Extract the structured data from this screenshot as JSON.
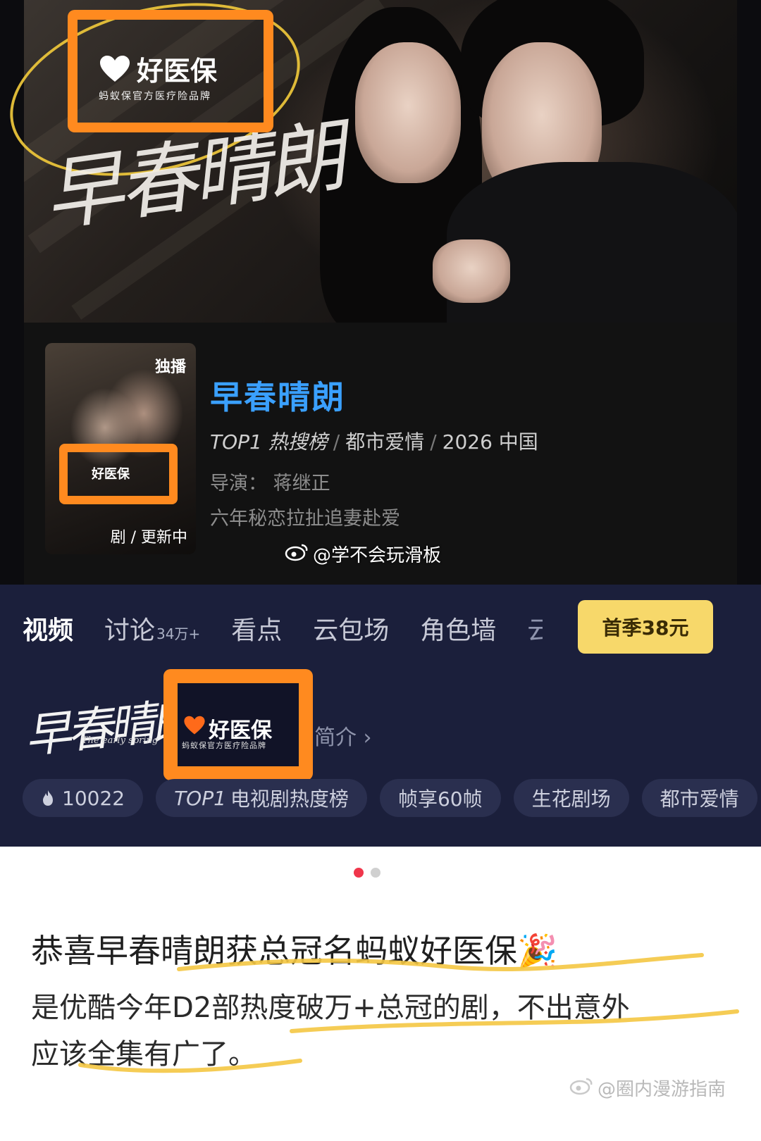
{
  "hero": {
    "title_art": "早春晴朗",
    "sponsor_logo": {
      "name": "好医保",
      "subtitle": "蚂蚁保官方医疗险品牌"
    }
  },
  "show": {
    "poster_badge": "独播",
    "poster_status": "剧 / 更新中",
    "poster_logo": "好医保",
    "title": "早春晴朗",
    "meta": {
      "rank": "TOP1 热搜榜",
      "genre": "都市爱情",
      "year_region": "2026 中国"
    },
    "director": "导演：  蒋继正",
    "tagline": "六年秘恋拉扯追妻赴爱"
  },
  "watermark_top": "@学不会玩滑板",
  "tabs": [
    {
      "label": "视频",
      "count": ""
    },
    {
      "label": "讨论",
      "count": "34万+"
    },
    {
      "label": "看点",
      "count": ""
    },
    {
      "label": "云包场",
      "count": ""
    },
    {
      "label": "角色墙",
      "count": ""
    },
    {
      "label": "云",
      "count": ""
    }
  ],
  "buy_button": "首季38元",
  "detail": {
    "script_logo": "早春晴朗",
    "script_logo_sub": "The early spring",
    "sponsor_name": "好医保",
    "sponsor_subtitle": "蚂蚁保官方医疗险品牌",
    "intro_link": "简介 ›"
  },
  "chips": [
    {
      "label": "10022",
      "icon": "flame-icon"
    },
    {
      "rank": "TOP1",
      "label": "电视剧热度榜"
    },
    {
      "label": "帧享60帧"
    },
    {
      "label": "生花剧场"
    },
    {
      "label": "都市爱情"
    }
  ],
  "post": {
    "title": "恭喜早春晴朗获总冠名蚂蚁好医保🎉",
    "body_line1": "是优酷今年D2部热度破万+总冠的剧，不出意外",
    "body_line2": "应该全集有广了。"
  },
  "watermark_bottom": "@圈内漫游指南",
  "colors": {
    "highlight_orange": "#ff8a1f",
    "circle_yellow": "#e9c33a",
    "title_blue": "#3aa0ff",
    "buy_yellow": "#f7d86a",
    "page_dot_active": "#f0364b",
    "navy_bg": "#1b1f3b"
  }
}
